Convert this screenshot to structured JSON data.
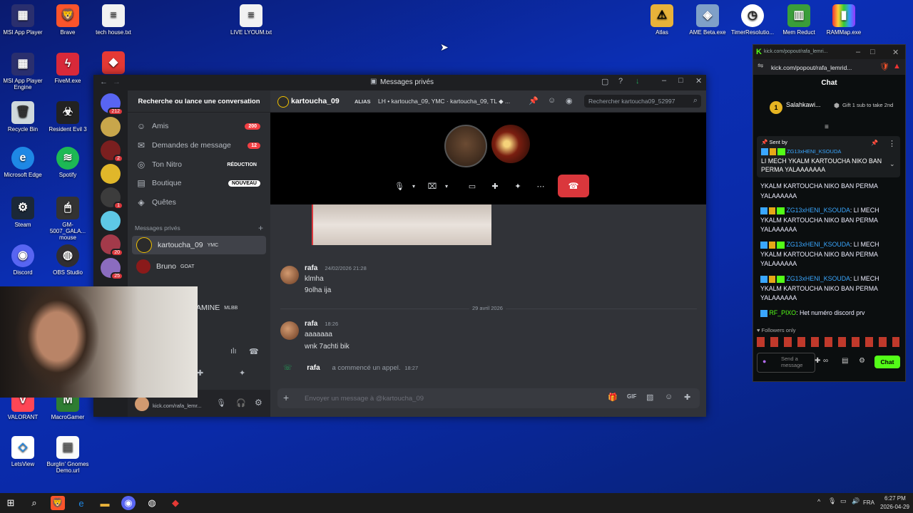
{
  "desktop": {
    "icons": [
      {
        "label": "MSI App Player"
      },
      {
        "label": "Brave"
      },
      {
        "label": "tech house.txt"
      },
      {
        "label": "LIVE LYOUM.txt"
      },
      {
        "label": "Atlas"
      },
      {
        "label": "AME Beta.exe"
      },
      {
        "label": "TimerResolutio..."
      },
      {
        "label": "Mem Reduct"
      },
      {
        "label": "RAMMap.exe"
      },
      {
        "label": "MSI App Player Engine"
      },
      {
        "label": "FiveM.exe"
      },
      {
        "label": "Recycle Bin"
      },
      {
        "label": "Resident Evil 3"
      },
      {
        "label": "Microsoft Edge"
      },
      {
        "label": "Spotify"
      },
      {
        "label": "Steam"
      },
      {
        "label": "GM-5007_GALA... mouse"
      },
      {
        "label": "Discord"
      },
      {
        "label": "OBS Studio"
      },
      {
        "label": "VALORANT"
      },
      {
        "label": "MacroGamer"
      },
      {
        "label": "LetsView"
      },
      {
        "label": "Burglin' Gnomes Demo.url"
      }
    ]
  },
  "discord": {
    "window_title": "Messages privés",
    "search_placeholder": "Recherche ou lance une conversation",
    "guild_badges": [
      "212",
      "2",
      "1",
      "20",
      "25"
    ],
    "nav": [
      {
        "label": "Amis",
        "badge": "200"
      },
      {
        "label": "Demandes de message",
        "badge": "12"
      },
      {
        "label": "Ton Nitro",
        "badge": "RÉDUCTION"
      },
      {
        "label": "Boutique",
        "badge": "NOUVEAU"
      },
      {
        "label": "Quêtes",
        "badge": ""
      }
    ],
    "dm_header": "Messages privés",
    "dms": [
      {
        "name": "kartoucha_09",
        "tag": "YMC"
      },
      {
        "name": "Bruno",
        "tag": "GOAT"
      },
      {
        "name": "AMINE",
        "tag": "MLBB"
      }
    ],
    "user_panel": {
      "status": "kick.com/rafa_lemr..."
    },
    "channel": {
      "name": "kartoucha_09",
      "alias_label": "ALIAS",
      "alias_text": "LH • kartoucha_09, YMC · kartoucha_09, TL ◆ ...",
      "search_placeholder": "Rechercher kartoucha09_52997"
    },
    "messages": [
      {
        "author": "rafa",
        "time": "24/02/2026 21:28",
        "lines": [
          "klmha",
          "9olha ija"
        ]
      },
      {
        "date_divider": "29 avril 2026"
      },
      {
        "author": "rafa",
        "time": "18:26",
        "lines": [
          "aaaaaaa",
          "wnk 7achti bik"
        ]
      },
      {
        "author": "rafa",
        "system": "a commencé un appel.",
        "time": "18:27"
      }
    ],
    "composer_placeholder": "Envoyer un message à @kartoucha_09"
  },
  "kick": {
    "url_title": "kick.com/popout/rafa_lemri...",
    "url": "kick.com/popout/rafa_lemrid...",
    "chat_title": "Chat",
    "gifter": {
      "name": "Salahkawi...",
      "count": "1",
      "gift_text": "Gift 1 sub to take 2nd"
    },
    "pinned": {
      "label": "Sent by",
      "user": "ZG13xHENI_KSOUDA",
      "text": "LI MECH YKALM KARTOUCHA NIKO BAN PERMA YALAAAAAAA"
    },
    "messages": [
      {
        "user": "",
        "text": "YKALM KARTOUCHA NIKO BAN PERMA YALAAAAAA"
      },
      {
        "user": "ZG13xHENI_KSOUDA",
        "text": ": LI MECH YKALM KARTOUCHA NIKO BAN PERMA YALAAAAAA"
      },
      {
        "user": "ZG13xHENI_KSOUDA",
        "text": ": LI MECH YKALM KARTOUCHA NIKO BAN PERMA YALAAAAAA"
      },
      {
        "user": "ZG13xHENI_KSOUDA",
        "text": ": LI MECH YKALM KARTOUCHA NIKO BAN PERMA YALAAAAAA"
      },
      {
        "user": "RF_PIXO",
        "text": ": Het numéro discord prv"
      }
    ],
    "followers_only": "Followers only",
    "send_placeholder": "Send a message",
    "chat_button": "Chat",
    "accent": "#53fc18"
  },
  "taskbar": {
    "lang": "FRA",
    "time": "6:27 PM",
    "date": "2026-04-29"
  }
}
